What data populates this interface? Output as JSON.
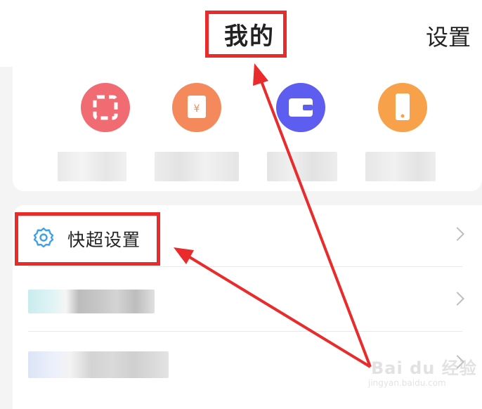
{
  "header": {
    "title": "我的",
    "settings_label": "设置"
  },
  "quick_actions": [
    {
      "icon": "scan-icon",
      "color": "#f06c72"
    },
    {
      "icon": "red-envelope-icon",
      "color": "#f48a5c"
    },
    {
      "icon": "wallet-icon",
      "color": "#5d5ef0"
    },
    {
      "icon": "phone-icon",
      "color": "#f7a24a"
    }
  ],
  "menu": {
    "rows": [
      {
        "label": "快超设置",
        "icon": "gear-icon"
      },
      {
        "label": ""
      },
      {
        "label": ""
      }
    ]
  },
  "watermark": {
    "main": "Bai du 经验",
    "sub": "jingyan.baidu.com"
  },
  "colors": {
    "annotation": "#ea2b2b",
    "gear_icon": "#3ea0e8"
  }
}
